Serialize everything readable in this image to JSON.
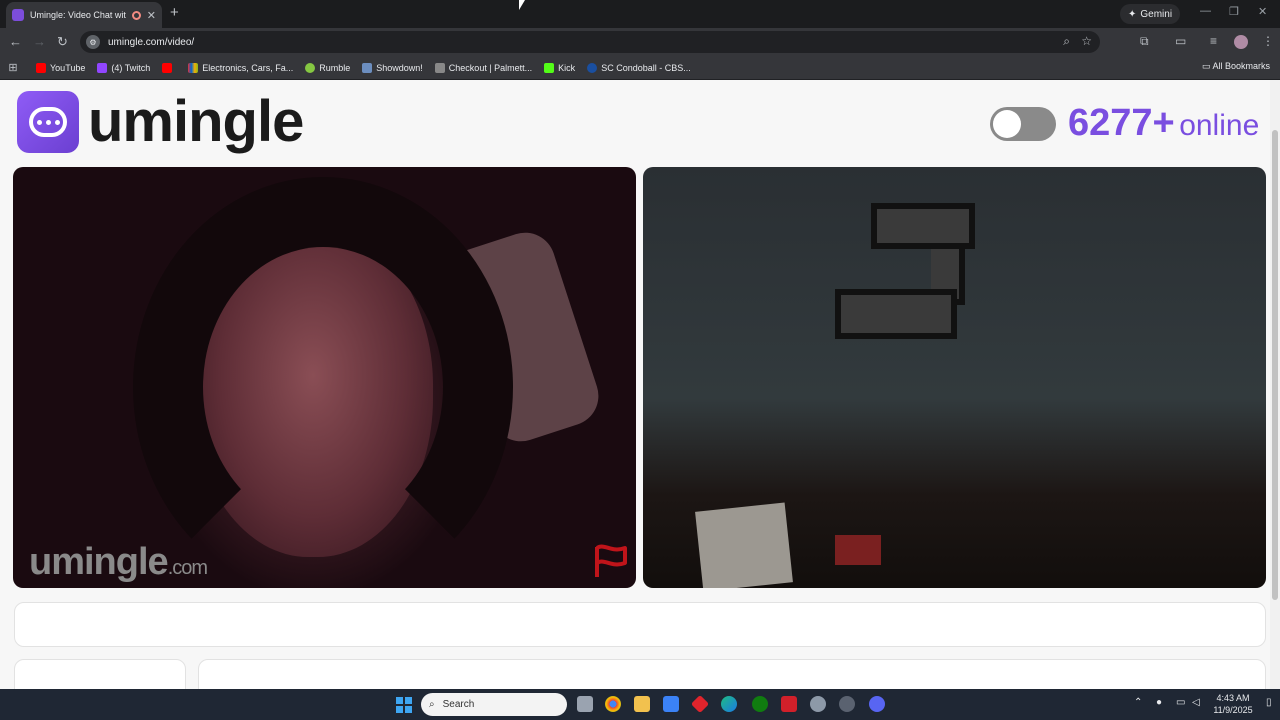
{
  "browser": {
    "tab_title": "Umingle: Video Chat with S",
    "new_tab": "+",
    "gemini_label": "Gemini",
    "url": "umingle.com/video/",
    "window_controls": [
      "—",
      "❐",
      "✕"
    ],
    "bookmarks": [
      {
        "label": "YouTube",
        "color": "#ff0000"
      },
      {
        "label": "(4) Twitch",
        "color": "#9146ff"
      },
      {
        "label": "",
        "color": "#ff0000"
      },
      {
        "label": "Electronics, Cars, Fa...",
        "color": "#e53238"
      },
      {
        "label": "Rumble",
        "color": "#85c742"
      },
      {
        "label": "Showdown!",
        "color": "#6c8ebf"
      },
      {
        "label": "Checkout | Palmett...",
        "color": "#888888"
      },
      {
        "label": "Kick",
        "color": "#53fc18"
      },
      {
        "label": "SC Condoball - CBS...",
        "color": "#1a4fa0"
      }
    ],
    "all_bookmarks": "All Bookmarks"
  },
  "site": {
    "logo_text": "umingle",
    "online_count": "6277+",
    "online_word": "online",
    "watermark_main": "umingle",
    "watermark_suffix": ".com",
    "accent_color": "#7a4ee0"
  },
  "taskbar": {
    "search_placeholder": "Search",
    "time": "4:43 AM",
    "date": "11/9/2025"
  }
}
